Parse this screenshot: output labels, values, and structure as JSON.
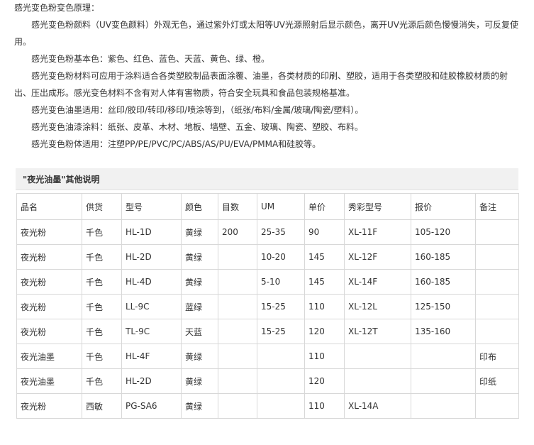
{
  "intro": [
    {
      "text": "感光变色粉变色原理：",
      "indent": false
    },
    {
      "text": "感光变色粉颜料（UV变色颜料）外观无色，通过紫外灯或太阳等UV光源照射后显示颜色，离开UV光源后颜色慢慢消失，可反复使用。",
      "indent": true
    },
    {
      "text": "感光变色粉基本色：紫色、红色、蓝色、天蓝、黄色、绿、橙。",
      "indent": true
    },
    {
      "text": "感光变色粉材料可应用于涂料适合各类塑胶制品表面涂覆、油墨，各类材质的印刷、塑胶，适用于各类塑胶和硅胶橡胶材质的射出、压出成形。感光变色材料不含有对人体有害物质，符合安全玩具和食品包装规格基准。",
      "indent": true
    },
    {
      "text": "感光变色油墨适用：丝印/胶印/转印/移印/喷涂等到，（纸张/布料/金属/玻璃/陶瓷/塑料）。",
      "indent": true
    },
    {
      "text": "感光变色油漆涂料：纸张、皮革、木材、地板、墙壁、五金、玻璃、陶瓷、塑胶、布料。",
      "indent": true
    },
    {
      "text": "感光变色粉体适用：注塑PP/PE/PVC/PC/ABS/AS/PU/EVA/PMMA和硅胶等。",
      "indent": true
    }
  ],
  "section_title": "\"夜光油墨\"其他说明",
  "table": {
    "headers": [
      "品名",
      "供货",
      "型号",
      "颜色",
      "目数",
      "UM",
      "单价",
      "秀彩型号",
      "报价",
      "备注"
    ],
    "rows": [
      [
        "夜光粉",
        "千色",
        "HL-1D",
        "黄绿",
        "200",
        "25-35",
        "90",
        "XL-11F",
        "105-120",
        ""
      ],
      [
        "夜光粉",
        "千色",
        "HL-2D",
        "黄绿",
        "",
        "10-20",
        "145",
        "XL-12F",
        "160-185",
        ""
      ],
      [
        "夜光粉",
        "千色",
        "HL-4D",
        "黄绿",
        "",
        "5-10",
        "145",
        "XL-14F",
        "160-185",
        ""
      ],
      [
        "夜光粉",
        "千色",
        "LL-9C",
        "蓝绿",
        "",
        "15-25",
        "110",
        "XL-12L",
        "125-150",
        ""
      ],
      [
        "夜光粉",
        "千色",
        "TL-9C",
        "天蓝",
        "",
        "15-25",
        "120",
        "XL-12T",
        "135-160",
        ""
      ],
      [
        "夜光油墨",
        "千色",
        "HL-4F",
        "黄绿",
        "",
        "",
        "110",
        "",
        "",
        "印布"
      ],
      [
        "夜光油墨",
        "千色",
        "HL-2D",
        "黄绿",
        "",
        "",
        "120",
        "",
        "",
        "印纸"
      ],
      [
        "夜光粉",
        "西敏",
        "PG-SA6",
        "黄绿",
        "",
        "",
        "110",
        "XL-14A",
        "",
        ""
      ]
    ]
  }
}
